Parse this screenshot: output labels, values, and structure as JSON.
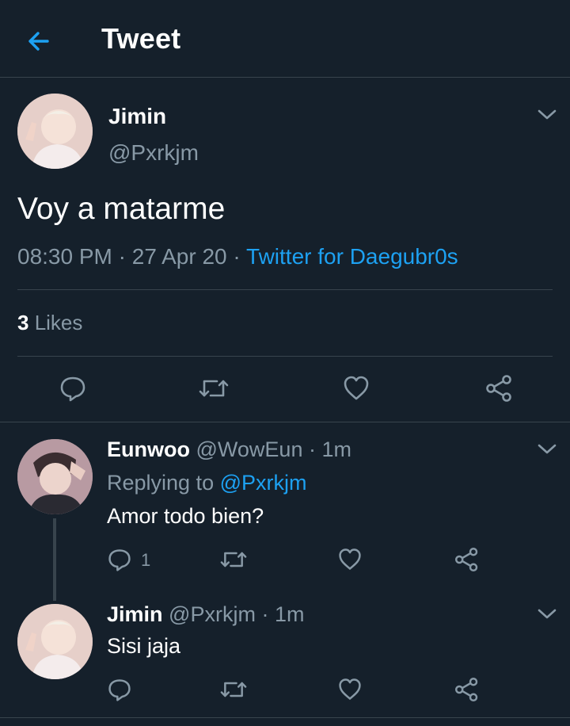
{
  "header": {
    "title": "Tweet"
  },
  "tweet": {
    "name": "Jimin",
    "handle": "@Pxrkjm",
    "text": "Voy a matarme",
    "time": "08:30 PM",
    "sep1": " · ",
    "date": "27 Apr 20",
    "sep2": " · ",
    "source": "Twitter for Daegubr0s",
    "likes_count": "3",
    "likes_label": " Likes"
  },
  "replies": [
    {
      "name": "Eunwoo",
      "handle": "@WowEun",
      "sep": " · ",
      "time": "1m",
      "replying_prefix": "Replying to ",
      "replying_to": "@Pxrkjm",
      "text": "Amor todo bien?",
      "reply_count": "1"
    },
    {
      "name": "Jimin",
      "handle": "@Pxrkjm",
      "sep": " · ",
      "time": "1m",
      "text": "Sisi jaja"
    }
  ],
  "icons": {
    "back": "arrow-left-icon",
    "more": "chevron-down-icon",
    "reply": "speech-bubble-icon",
    "retweet": "retweet-icon",
    "like": "heart-icon",
    "share": "share-icon"
  },
  "colors": {
    "background": "#15202b",
    "accent": "#1da1f2",
    "secondary_text": "#8899a6",
    "divider": "#38444d"
  }
}
